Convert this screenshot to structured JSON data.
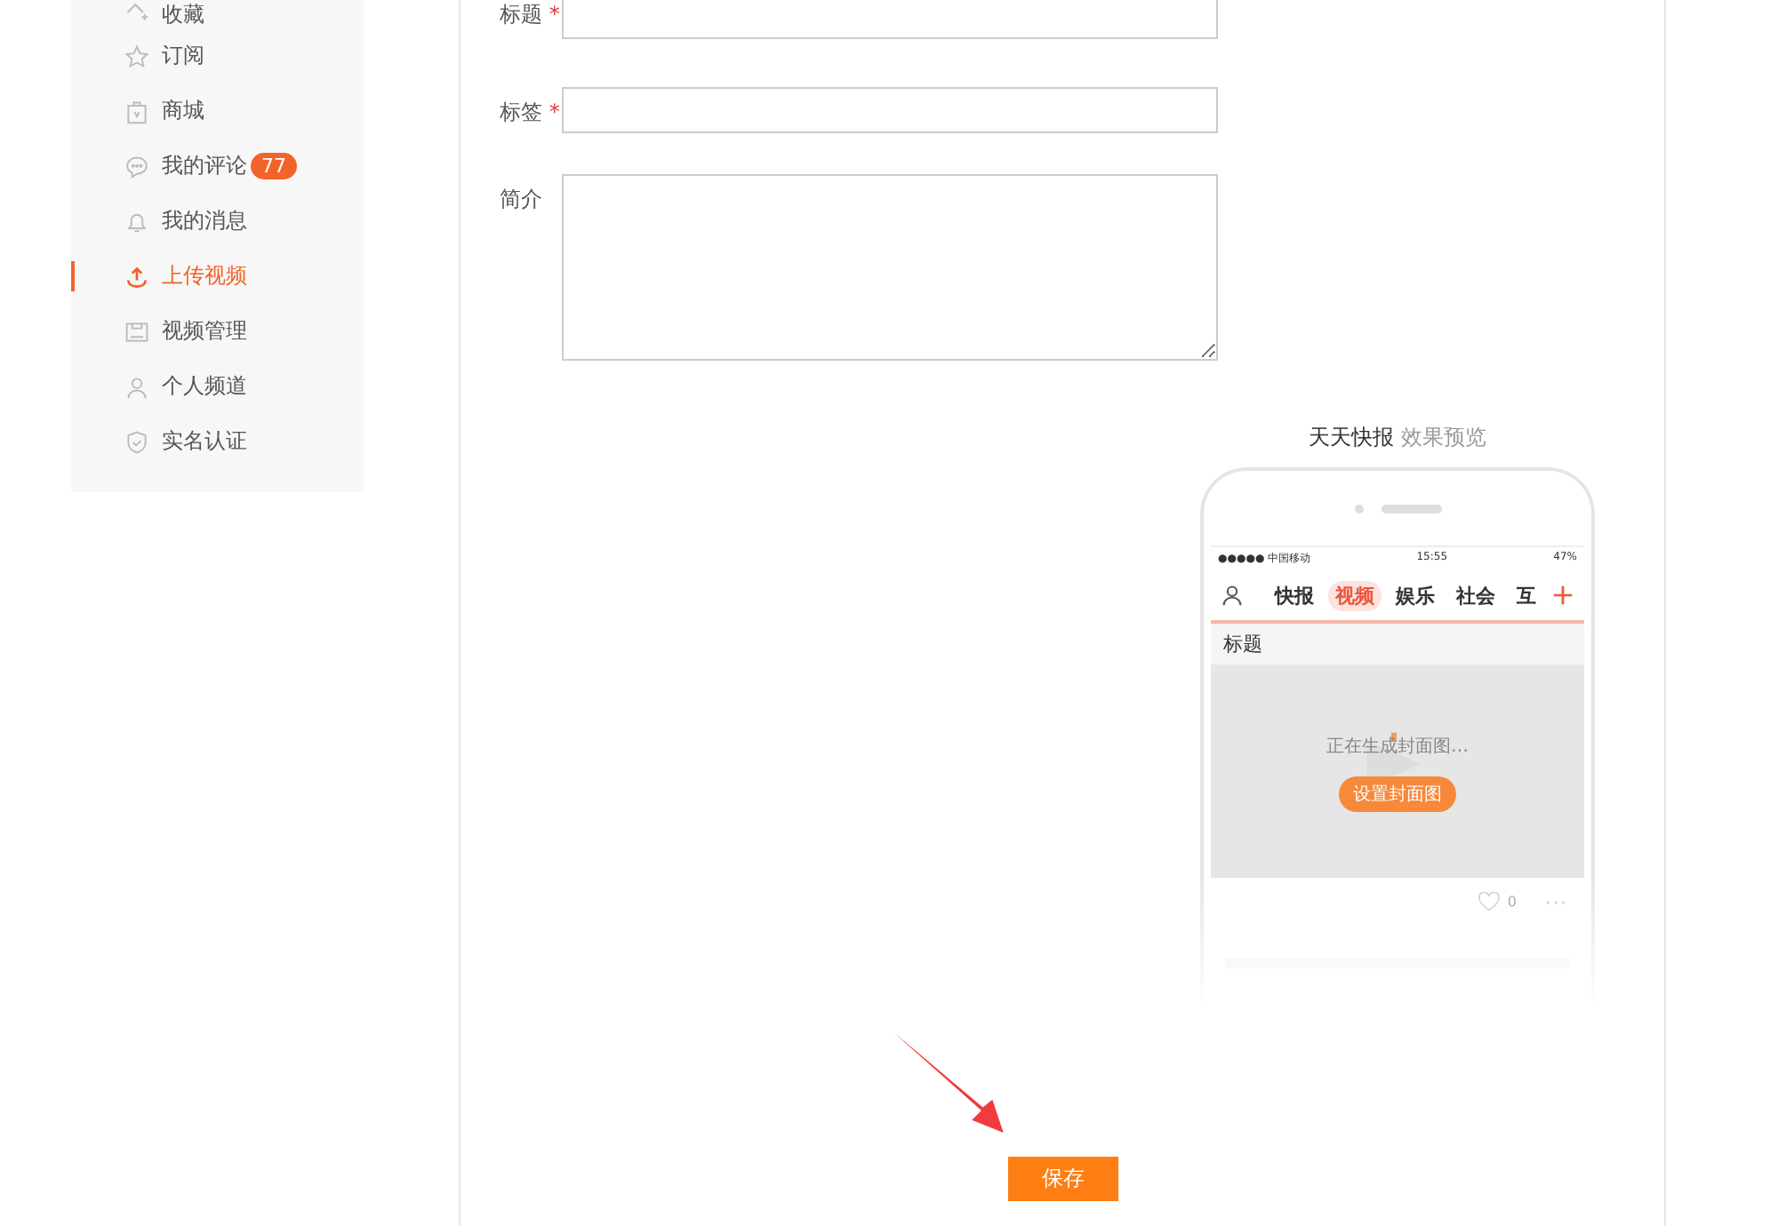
{
  "sidebar": {
    "items": [
      {
        "label": "收藏",
        "selected": false
      },
      {
        "label": "订阅",
        "selected": false
      },
      {
        "label": "商城",
        "selected": false
      },
      {
        "label": "我的评论",
        "selected": false,
        "badge": "77"
      },
      {
        "label": "我的消息",
        "selected": false
      },
      {
        "label": "上传视频",
        "selected": true
      },
      {
        "label": "视频管理",
        "selected": false
      },
      {
        "label": "个人频道",
        "selected": false
      },
      {
        "label": "实名认证",
        "selected": false
      }
    ]
  },
  "form": {
    "fields": [
      {
        "label": "标题",
        "required": true,
        "kind": "input"
      },
      {
        "label": "标签",
        "required": true,
        "kind": "input"
      },
      {
        "label": "简介",
        "required": false,
        "kind": "textarea"
      }
    ],
    "required_mark": "*"
  },
  "preview": {
    "app_name": "天天快报",
    "caption": "效果预览",
    "status_bar": {
      "carrier": "●●●●● 中国移动",
      "time": "15:55",
      "battery": "47%"
    },
    "tabs": [
      {
        "label": "快报",
        "selected": false
      },
      {
        "label": "视频",
        "selected": true
      },
      {
        "label": "娱乐",
        "selected": false
      },
      {
        "label": "社会",
        "selected": false
      },
      {
        "label": "互",
        "selected": false
      }
    ],
    "title": "标题",
    "status": "正在生成封面图…",
    "cover_button": "设置封面图",
    "likes": "0"
  },
  "save_button": "保存"
}
